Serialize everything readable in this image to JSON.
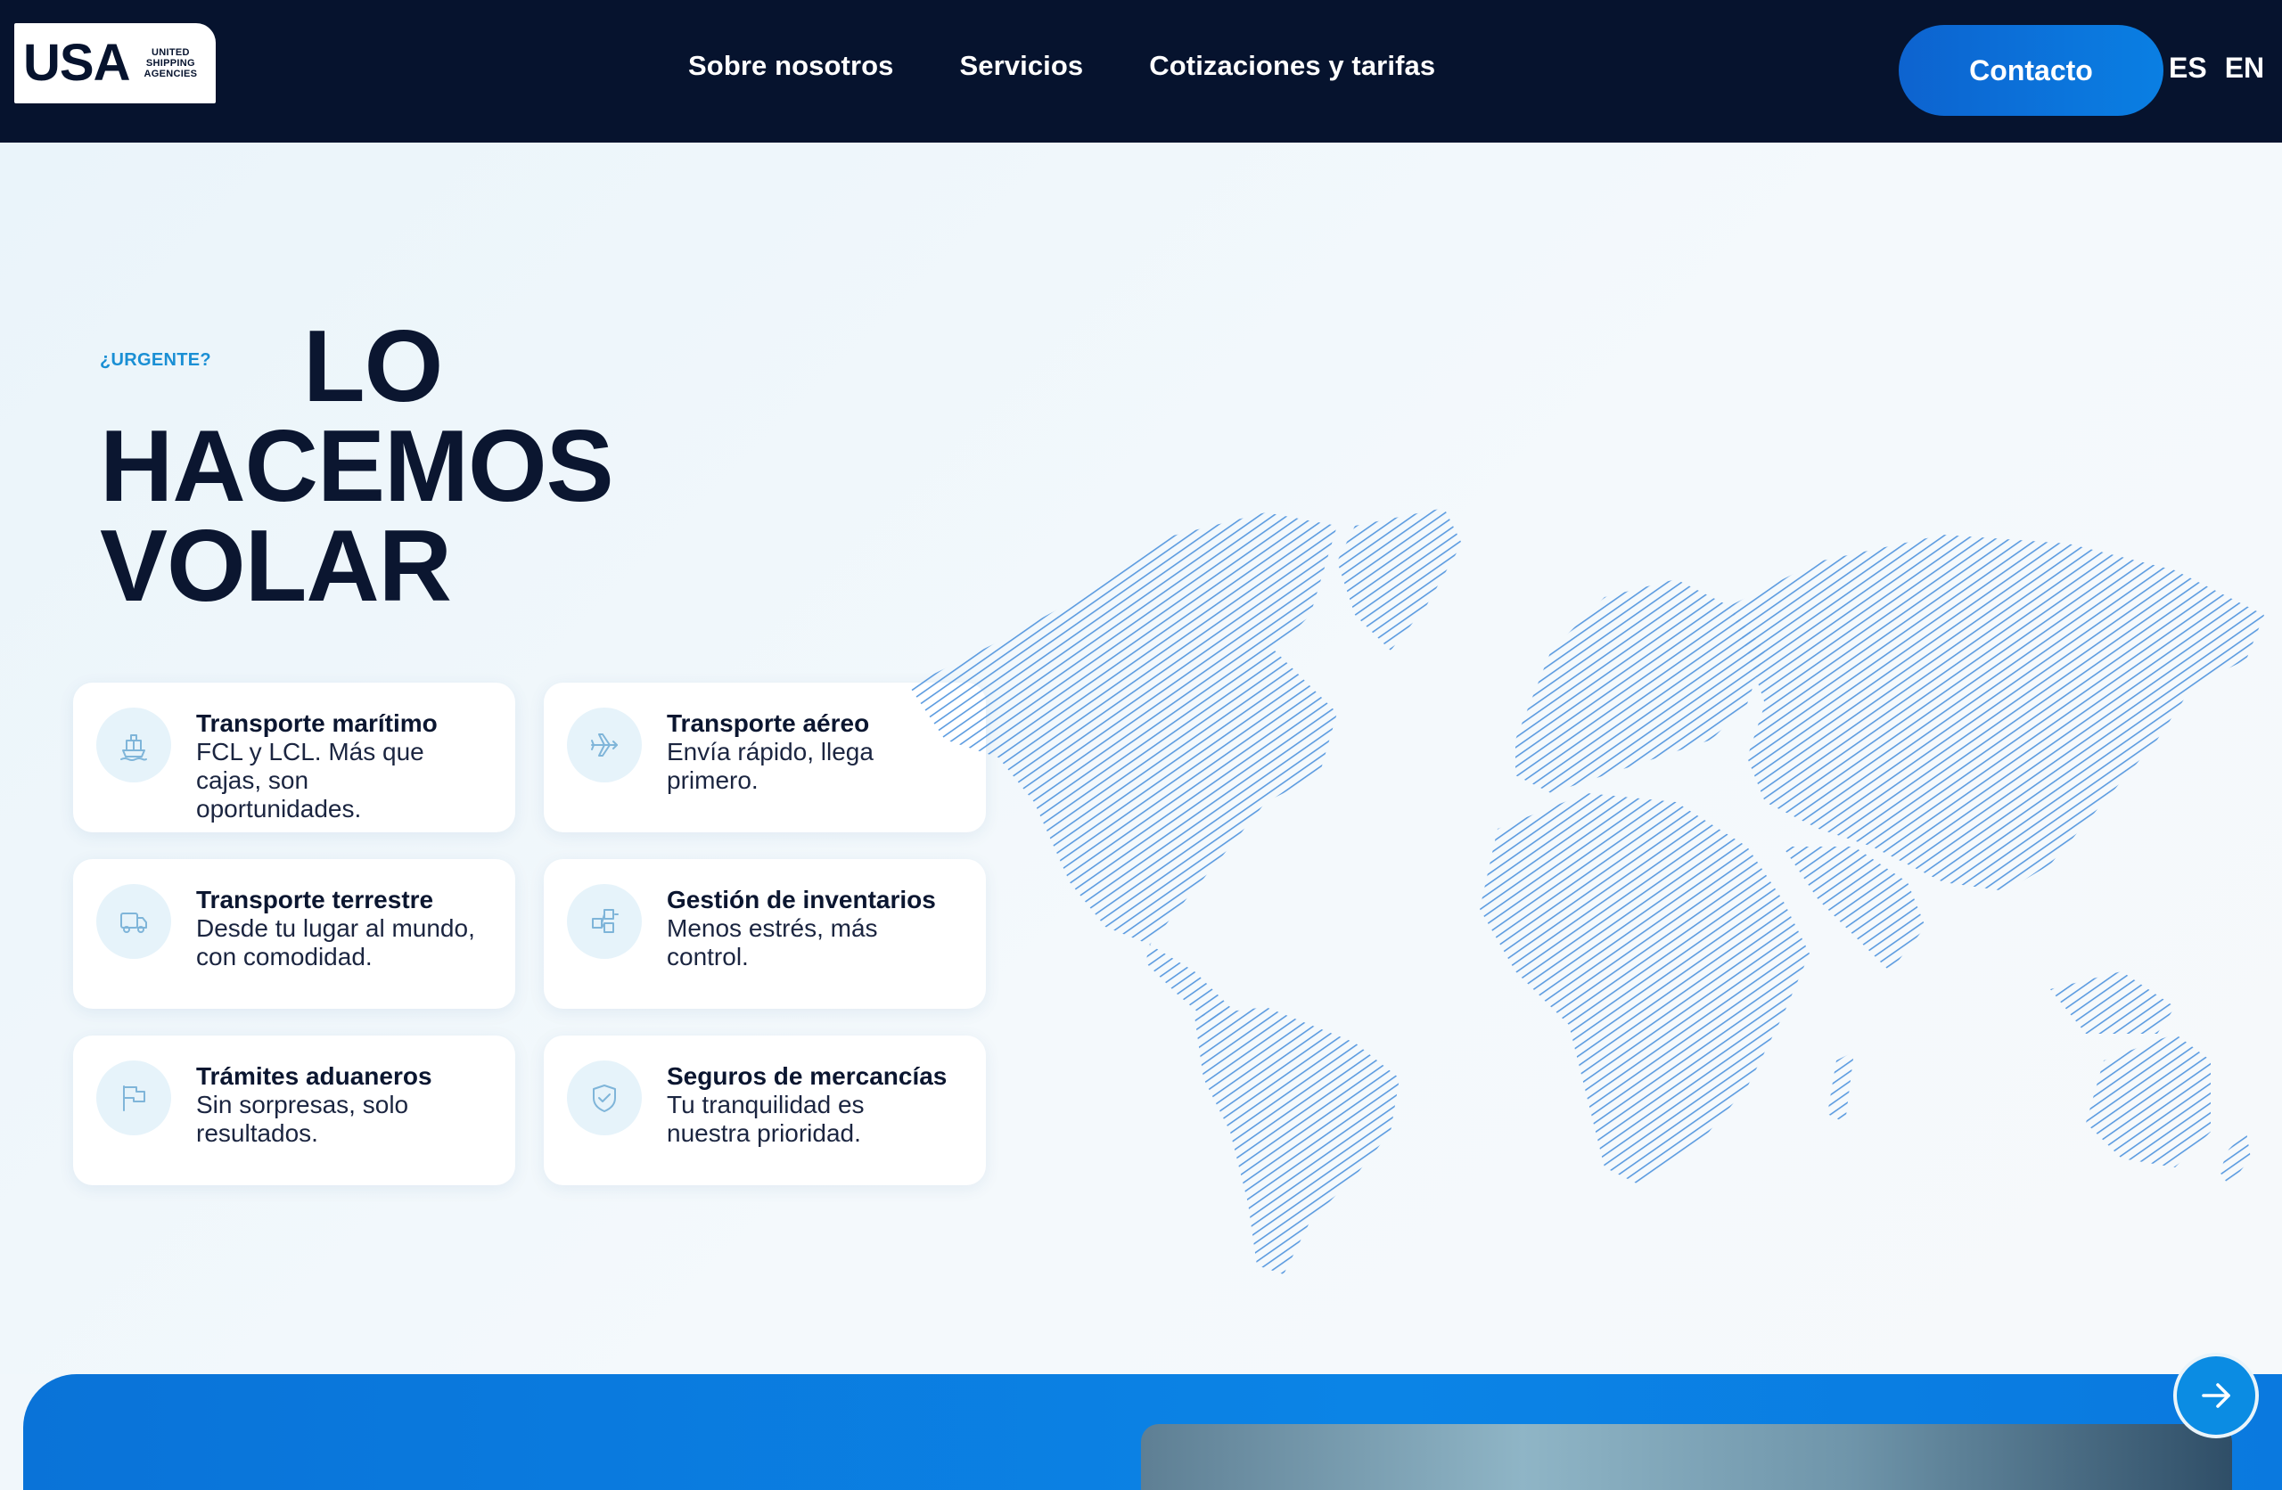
{
  "brand": {
    "logo_text": "USA",
    "logo_sub": [
      "UNITED",
      "SHIPPING",
      "AGENCIES"
    ]
  },
  "nav": {
    "items": [
      "Sobre nosotros",
      "Servicios",
      "Cotizaciones y tarifas"
    ],
    "contact_label": "Contacto",
    "languages": [
      "ES",
      "EN"
    ]
  },
  "hero": {
    "eyebrow": "¿URGENTE?",
    "headline": [
      "LO",
      "HACEMOS",
      "VOLAR"
    ]
  },
  "services": [
    {
      "icon": "ship-icon",
      "title": "Transporte marítimo",
      "desc": "FCL y LCL. Más que cajas, son oportunidades."
    },
    {
      "icon": "plane-icon",
      "title": "Transporte aéreo",
      "desc": "Envía rápido, llega primero."
    },
    {
      "icon": "truck-icon",
      "title": "Transporte terrestre",
      "desc": "Desde tu lugar al mundo, con comodidad."
    },
    {
      "icon": "inventory-icon",
      "title": "Gestión de inventarios",
      "desc": "Menos estrés, más control."
    },
    {
      "icon": "flag-icon",
      "title": "Trámites aduaneros",
      "desc": "Sin sorpresas, solo resultados."
    },
    {
      "icon": "shield-check-icon",
      "title": "Seguros de mercancías",
      "desc": "Tu tranquilidad es nuestra prioridad."
    }
  ],
  "colors": {
    "header_bg": "#06132e",
    "accent": "#0b84e6",
    "map_lines": "#5b9be0",
    "headline": "#0b1630"
  }
}
